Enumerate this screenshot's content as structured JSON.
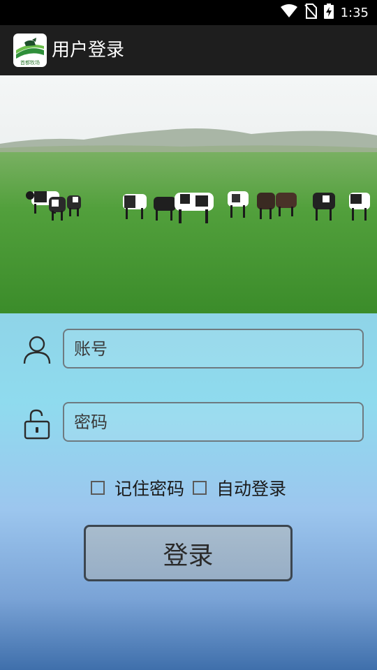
{
  "status_bar": {
    "time": "1:35",
    "icons": [
      "wifi-icon",
      "no-sim-icon",
      "battery-charging-icon"
    ]
  },
  "app_bar": {
    "title": "用户登录",
    "logo_text": "首都牧场",
    "colors": {
      "background": "#1e1e1e",
      "title": "#ffffff"
    }
  },
  "login_form": {
    "account": {
      "placeholder": "账号",
      "value": "",
      "icon": "user-icon"
    },
    "password": {
      "placeholder": "密码",
      "value": "",
      "icon": "unlock-icon"
    },
    "remember_password": {
      "label": "记住密码",
      "checked": false
    },
    "auto_login": {
      "label": "自动登录",
      "checked": false
    },
    "login_button": "登录"
  }
}
